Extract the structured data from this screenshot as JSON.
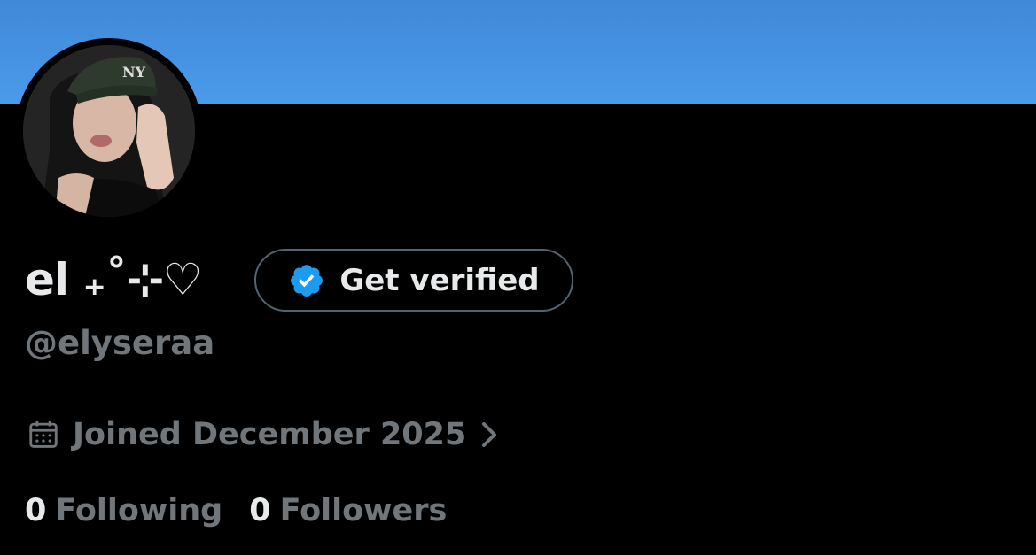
{
  "profile": {
    "display_name": "el ₊˚⊹♡",
    "handle": "@elyseraa",
    "joined": "Joined December 2025",
    "following_count": "0",
    "following_label": "Following",
    "followers_count": "0",
    "followers_label": "Followers"
  },
  "verify_button": {
    "label": "Get verified"
  },
  "icons": {
    "verify": "verified-badge-icon",
    "calendar": "calendar-icon",
    "chevron": "chevron-right-icon"
  },
  "colors": {
    "banner": "#4a99e9",
    "background": "#000000",
    "primary_text": "#e7e9ea",
    "secondary_text": "#71767b",
    "badge": "#1d9bf0"
  }
}
